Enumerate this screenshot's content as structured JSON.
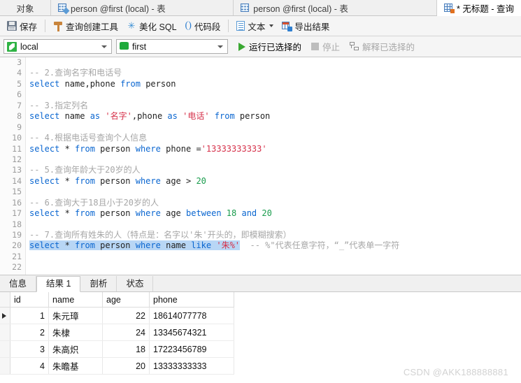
{
  "tabbar": {
    "tabs": [
      {
        "label": "对象",
        "icon": "",
        "active": false
      },
      {
        "label": "person @first (local) - 表",
        "icon": "table-edit-icon",
        "active": false
      },
      {
        "label": "person @first (local) - 表",
        "icon": "table-icon",
        "active": false
      },
      {
        "label": "* 无标题 - 查询",
        "icon": "query-icon",
        "active": true
      }
    ]
  },
  "toolbar": {
    "save_label": "保存",
    "query_builder_label": "查询创建工具",
    "beautify_sql_label": "美化 SQL",
    "code_snippet_label": "代码段",
    "text_label": "文本",
    "export_result_label": "导出结果"
  },
  "connbar": {
    "connection_value": "local",
    "database_value": "first",
    "run_selected_label": "运行已选择的",
    "stop_label": "停止",
    "explain_selected_label": "解释已选择的"
  },
  "editor": {
    "first_line_number": 3,
    "lines": [
      {
        "n": 3,
        "tokens": []
      },
      {
        "n": 4,
        "tokens": [
          {
            "t": "-- 2.查询名字和电话号",
            "c": "cm"
          }
        ]
      },
      {
        "n": 5,
        "tokens": [
          {
            "t": "select ",
            "c": "kw"
          },
          {
            "t": "name,phone ",
            "c": "pl"
          },
          {
            "t": "from ",
            "c": "kw"
          },
          {
            "t": "person",
            "c": "pl"
          }
        ]
      },
      {
        "n": 6,
        "tokens": []
      },
      {
        "n": 7,
        "tokens": [
          {
            "t": "-- 3.指定列名",
            "c": "cm"
          }
        ]
      },
      {
        "n": 8,
        "tokens": [
          {
            "t": "select ",
            "c": "kw"
          },
          {
            "t": "name ",
            "c": "pl"
          },
          {
            "t": "as ",
            "c": "kw"
          },
          {
            "t": "'名字'",
            "c": "lit"
          },
          {
            "t": ",phone ",
            "c": "pl"
          },
          {
            "t": "as ",
            "c": "kw"
          },
          {
            "t": "'电话' ",
            "c": "lit"
          },
          {
            "t": "from ",
            "c": "kw"
          },
          {
            "t": "person",
            "c": "pl"
          }
        ]
      },
      {
        "n": 9,
        "tokens": []
      },
      {
        "n": 10,
        "tokens": [
          {
            "t": "-- 4.根据电话号查询个人信息",
            "c": "cm"
          }
        ]
      },
      {
        "n": 11,
        "tokens": [
          {
            "t": "select ",
            "c": "kw"
          },
          {
            "t": "* ",
            "c": "pl"
          },
          {
            "t": "from ",
            "c": "kw"
          },
          {
            "t": "person ",
            "c": "pl"
          },
          {
            "t": "where ",
            "c": "kw"
          },
          {
            "t": "phone =",
            "c": "pl"
          },
          {
            "t": "'13333333333'",
            "c": "lit"
          }
        ]
      },
      {
        "n": 12,
        "tokens": []
      },
      {
        "n": 13,
        "tokens": [
          {
            "t": "-- 5.查询年龄大于20岁的人",
            "c": "cm"
          }
        ]
      },
      {
        "n": 14,
        "tokens": [
          {
            "t": "select ",
            "c": "kw"
          },
          {
            "t": "* ",
            "c": "pl"
          },
          {
            "t": "from ",
            "c": "kw"
          },
          {
            "t": "person ",
            "c": "pl"
          },
          {
            "t": "where ",
            "c": "kw"
          },
          {
            "t": "age > ",
            "c": "pl"
          },
          {
            "t": "20",
            "c": "num"
          }
        ]
      },
      {
        "n": 15,
        "tokens": []
      },
      {
        "n": 16,
        "tokens": [
          {
            "t": "-- 6.查询大于18且小于20岁的人",
            "c": "cm"
          }
        ]
      },
      {
        "n": 17,
        "tokens": [
          {
            "t": "select ",
            "c": "kw"
          },
          {
            "t": "* ",
            "c": "pl"
          },
          {
            "t": "from ",
            "c": "kw"
          },
          {
            "t": "person ",
            "c": "pl"
          },
          {
            "t": "where ",
            "c": "kw"
          },
          {
            "t": "age ",
            "c": "pl"
          },
          {
            "t": "between ",
            "c": "kw"
          },
          {
            "t": "18 ",
            "c": "num"
          },
          {
            "t": "and ",
            "c": "kw"
          },
          {
            "t": "20",
            "c": "num"
          }
        ]
      },
      {
        "n": 18,
        "tokens": []
      },
      {
        "n": 19,
        "tokens": [
          {
            "t": "-- 7.查询所有姓朱的人（特点是：名字以'朱'开头的，即模糊搜索）",
            "c": "cm"
          }
        ]
      },
      {
        "n": 20,
        "tokens": [
          {
            "t": "select ",
            "c": "kw",
            "sel": true
          },
          {
            "t": "* ",
            "c": "pl",
            "sel": true
          },
          {
            "t": "from ",
            "c": "kw",
            "sel": true
          },
          {
            "t": "person ",
            "c": "pl",
            "sel": true
          },
          {
            "t": "where ",
            "c": "kw",
            "sel": true
          },
          {
            "t": "name ",
            "c": "pl",
            "sel": true
          },
          {
            "t": "like ",
            "c": "kw",
            "sel": true
          },
          {
            "t": "'朱%'",
            "c": "lit",
            "sel": true
          },
          {
            "t": "  -- %\"代表任意字符，“_”代表单一字符",
            "c": "cm"
          }
        ]
      },
      {
        "n": 21,
        "tokens": []
      },
      {
        "n": 22,
        "tokens": []
      }
    ]
  },
  "result_tabs": [
    {
      "label": "信息",
      "active": false
    },
    {
      "label": "结果 1",
      "active": true
    },
    {
      "label": "剖析",
      "active": false
    },
    {
      "label": "状态",
      "active": false
    }
  ],
  "result_grid": {
    "columns": [
      "id",
      "name",
      "age",
      "phone"
    ],
    "rows": [
      {
        "selected": true,
        "id": "1",
        "name": "朱元璋",
        "age": "22",
        "phone": "18614077778"
      },
      {
        "selected": false,
        "id": "2",
        "name": "朱棣",
        "age": "24",
        "phone": "13345674321"
      },
      {
        "selected": false,
        "id": "3",
        "name": "朱高炽",
        "age": "18",
        "phone": "17223456789"
      },
      {
        "selected": false,
        "id": "4",
        "name": "朱瞻基",
        "age": "20",
        "phone": "13333333333"
      }
    ]
  },
  "watermark": {
    "text": "CSDN @AKK188888881"
  },
  "colors": {
    "keyword": "#0a66d0",
    "literal": "#d6314a",
    "number": "#1a9c4d",
    "comment": "#a6a6a6",
    "selection": "#b8d6f5",
    "accent_green": "#2fb344"
  }
}
